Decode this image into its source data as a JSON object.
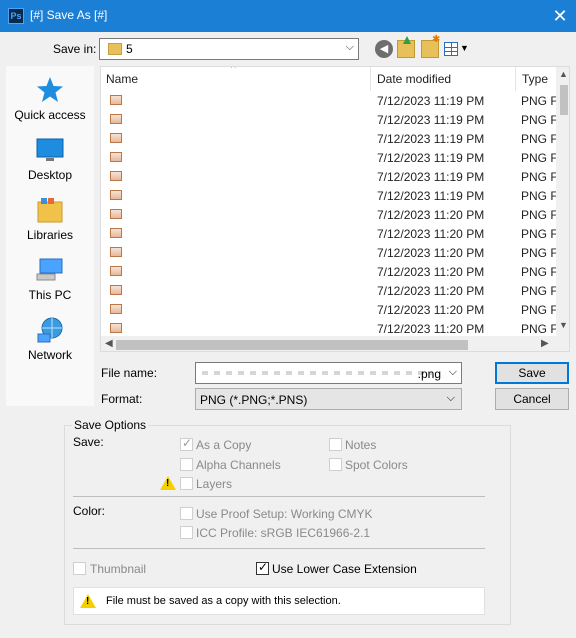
{
  "window": {
    "title": "[#] Save As [#]",
    "app_icon": "Ps",
    "close_glyph": "✕"
  },
  "save_in": {
    "label": "Save in:",
    "value": "5"
  },
  "places": [
    {
      "label": "Quick access",
      "icon": "star-icon"
    },
    {
      "label": "Desktop",
      "icon": "desktop-icon"
    },
    {
      "label": "Libraries",
      "icon": "libraries-icon"
    },
    {
      "label": "This PC",
      "icon": "computer-icon"
    },
    {
      "label": "Network",
      "icon": "network-icon"
    }
  ],
  "columns": {
    "name": "Name",
    "date": "Date modified",
    "type": "Type"
  },
  "files": [
    {
      "date": "7/12/2023 11:19 PM",
      "type": "PNG File"
    },
    {
      "date": "7/12/2023 11:19 PM",
      "type": "PNG File"
    },
    {
      "date": "7/12/2023 11:19 PM",
      "type": "PNG File"
    },
    {
      "date": "7/12/2023 11:19 PM",
      "type": "PNG File"
    },
    {
      "date": "7/12/2023 11:19 PM",
      "type": "PNG File"
    },
    {
      "date": "7/12/2023 11:19 PM",
      "type": "PNG File"
    },
    {
      "date": "7/12/2023 11:20 PM",
      "type": "PNG File"
    },
    {
      "date": "7/12/2023 11:20 PM",
      "type": "PNG File"
    },
    {
      "date": "7/12/2023 11:20 PM",
      "type": "PNG File"
    },
    {
      "date": "7/12/2023 11:20 PM",
      "type": "PNG File"
    },
    {
      "date": "7/12/2023 11:20 PM",
      "type": "PNG File"
    },
    {
      "date": "7/12/2023 11:20 PM",
      "type": "PNG File"
    },
    {
      "date": "7/12/2023 11:20 PM",
      "type": "PNG File"
    }
  ],
  "file_name": {
    "label": "File name:",
    "value": ".png"
  },
  "format": {
    "label": "Format:",
    "value": "PNG (*.PNG;*.PNS)"
  },
  "buttons": {
    "save": "Save",
    "cancel": "Cancel"
  },
  "options": {
    "title": "Save Options",
    "save_label": "Save:",
    "as_a_copy": "As a Copy",
    "notes": "Notes",
    "alpha_channels": "Alpha Channels",
    "spot_colors": "Spot Colors",
    "layers": "Layers",
    "color_label": "Color:",
    "use_proof_setup": "Use Proof Setup:  Working CMYK",
    "icc_profile": "ICC Profile:  sRGB IEC61966-2.1",
    "thumbnail": "Thumbnail",
    "lower_case_ext": "Use Lower Case Extension",
    "message": "File must be saved as a copy with this selection."
  },
  "colors": {
    "titlebar": "#1c7fd6",
    "accent": "#0078d7",
    "warning": "#f5d000"
  }
}
